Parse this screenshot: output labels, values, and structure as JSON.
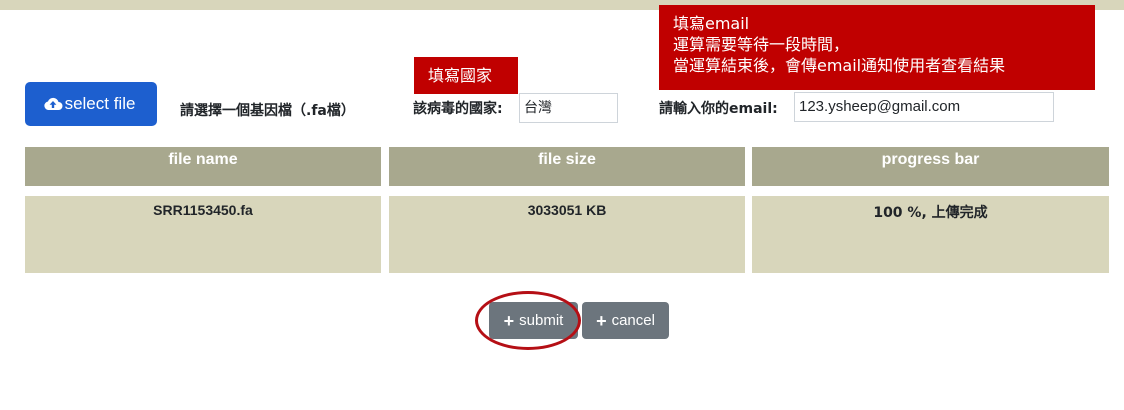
{
  "annotations": {
    "country_note": "填寫國家",
    "email_note_lines": [
      "填寫email",
      "運算需要等待一段時間，",
      "當運算結束後，會傳email通知使用者查看結果"
    ]
  },
  "form": {
    "select_file_label": "select file",
    "file_hint": "請選擇一個基因檔（.fa檔）",
    "country_label": "該病毒的國家:",
    "country_value": "台灣",
    "email_label": "請輸入你的email:",
    "email_value": "123.ysheep@gmail.com"
  },
  "table": {
    "headers": [
      "file name",
      "file size",
      "progress bar"
    ],
    "rows": [
      [
        "SRR1153450.fa",
        "3033051 KB",
        "100 %, 上傳完成"
      ]
    ]
  },
  "actions": {
    "submit_label": "submit",
    "cancel_label": "cancel"
  },
  "colors": {
    "accent_blue": "#1d5fcf",
    "header_bg": "#a8a88e",
    "row_bg": "#d8d6bb",
    "annotation_red": "#c00000",
    "button_gray": "#6c757d"
  }
}
